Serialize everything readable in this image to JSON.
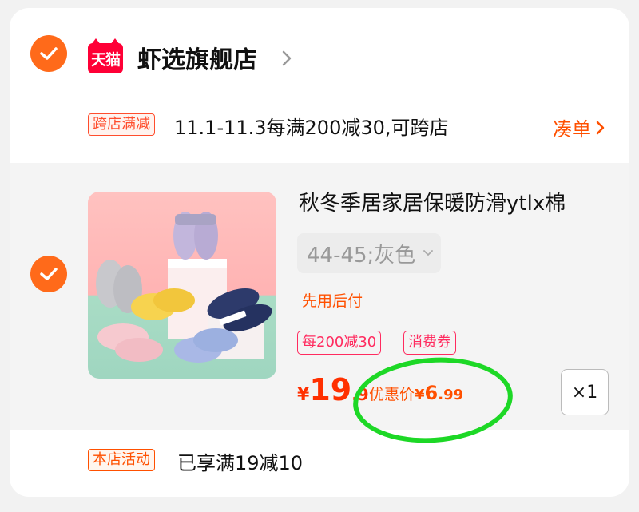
{
  "shop": {
    "logo_text": "天猫",
    "name": "虾选旗舰店"
  },
  "promo": {
    "tag": "跨店满减",
    "text": "11.1-11.3每满200减30,可跨店",
    "action_label": "凑单"
  },
  "item": {
    "title": "秋冬季居家居保暖防滑ytlx棉",
    "spec": "44-45;灰色",
    "pay_later": "先用后付",
    "badges": [
      "每200减30",
      "消费券"
    ],
    "price": {
      "yen": "¥",
      "integer": "19",
      "decimal": ".9"
    },
    "discount": {
      "label": "优惠价",
      "yen": "¥",
      "integer": "6",
      "decimal": ".99"
    },
    "quantity": "×1",
    "checked": true
  },
  "activity": {
    "tag": "本店活动",
    "text": "已享满19减10"
  },
  "colors": {
    "accent": "#ff6a1a",
    "price": "#ff3000",
    "tmall_red": "#ff0036",
    "highlight_circle": "#1dd826"
  }
}
